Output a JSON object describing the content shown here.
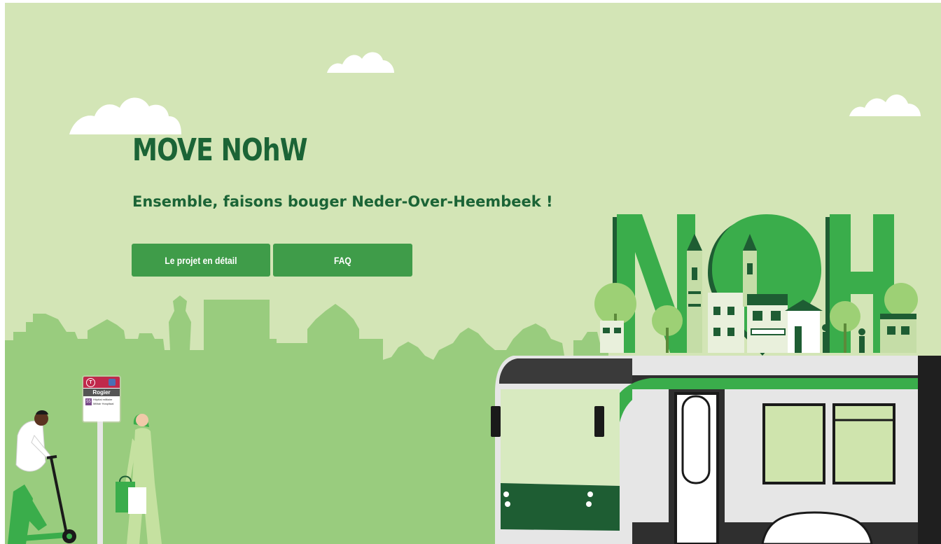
{
  "hero": {
    "title": "MOVE NOhW",
    "subtitle": "Ensemble, faisons bouger Neder-Over-Heembeek !",
    "buttons": {
      "projet_label": "Le projet en détail",
      "faq_label": "FAQ"
    }
  },
  "illustration": {
    "nowh_letters": "NOH",
    "bus_stop": {
      "badge": "T",
      "name": "Rogier",
      "line_number": "55",
      "line_info_1": "Hôpital militaire",
      "line_info_2": "Militair Hospitaal"
    }
  },
  "colors": {
    "background": "#d3e5b6",
    "skyline": "#99cc7e",
    "title": "#1b6436",
    "button": "#3f9c49",
    "letters": "#3aad4b",
    "tram_dark": "#2f2f2f",
    "tram_light": "#e6e6e6"
  }
}
